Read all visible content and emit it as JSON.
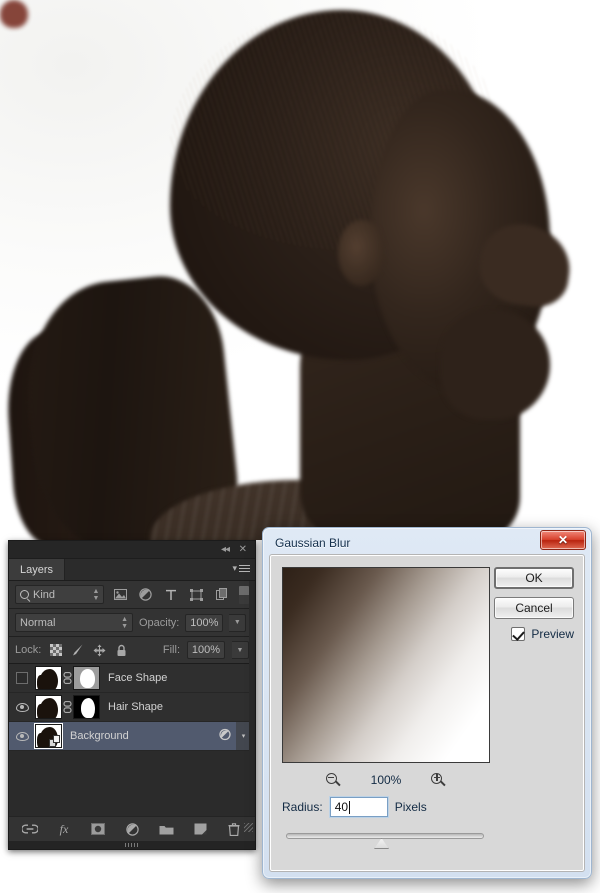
{
  "photo": {
    "description": "dark silhouette profile of a woman with a ponytail on white background",
    "alt": "Silhouetted profile portrait"
  },
  "layers_panel": {
    "titlebar": {
      "collapse_label": "◂◂",
      "close_label": "✕"
    },
    "tab_label": "Layers",
    "menu_label": "▾",
    "filter": {
      "kind_label": "Kind",
      "icons": [
        "image-filter-icon",
        "adjustment-filter-icon",
        "type-filter-icon",
        "shape-filter-icon",
        "smartobject-filter-icon"
      ],
      "toggle_name": "filter-toggle-pill"
    },
    "blend": {
      "mode": "Normal",
      "opacity_label": "Opacity:",
      "opacity_value": "100%"
    },
    "lock": {
      "label": "Lock:",
      "icons": [
        "lock-transparent-icon",
        "lock-image-icon",
        "lock-position-icon",
        "lock-all-icon"
      ],
      "fill_label": "Fill:",
      "fill_value": "100%"
    },
    "layers": [
      {
        "name": "Face Shape",
        "visible": false,
        "selected": false,
        "has_mask": true,
        "mask_bg": "#9c9c9c",
        "mask_fg": "#ffffff",
        "linked": true
      },
      {
        "name": "Hair Shape",
        "visible": true,
        "selected": false,
        "has_mask": true,
        "mask_bg": "#000000",
        "mask_fg": "#ffffff",
        "linked": true
      },
      {
        "name": "Background",
        "visible": true,
        "selected": true,
        "has_mask": false,
        "badge": "smartobject-badge",
        "fx_icon": "layer-effects-icon",
        "caret": "▾"
      }
    ],
    "bottom_bar_icons": [
      "link-layers-icon",
      "layer-styles-fx-icon",
      "add-mask-icon",
      "adjustment-layer-icon",
      "new-group-icon",
      "new-layer-icon",
      "delete-layer-icon"
    ],
    "fx_label": "fx"
  },
  "dialog": {
    "title": "Gaussian Blur",
    "close_label": "✕",
    "ok_label": "OK",
    "cancel_label": "Cancel",
    "preview_label": "Preview",
    "preview_checked": true,
    "zoom_value": "100%",
    "zoom_out_name": "zoom-out-icon",
    "zoom_in_name": "zoom-in-icon",
    "radius_label": "Radius:",
    "radius_value": "40",
    "radius_units": "Pixels",
    "slider_percent": 48
  },
  "colors": {
    "panel_bg": "#2b2b2b",
    "panel_row": "#333333",
    "selected_layer": "#515a6e",
    "dialog_bg": "#d8d8d8",
    "dialog_chrome": "#dfe9f5",
    "close_red": "#d8402c",
    "text_light": "#c8c8c8",
    "text_dark": "#132b44"
  }
}
